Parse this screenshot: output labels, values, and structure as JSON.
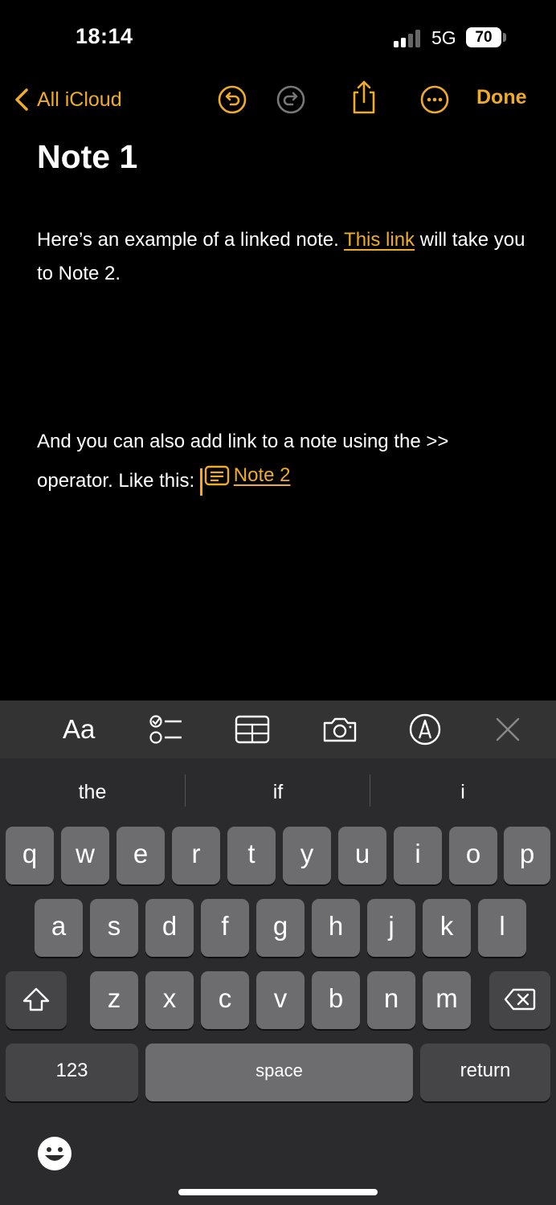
{
  "status_bar": {
    "time": "18:14",
    "network": "5G",
    "battery": "70"
  },
  "nav": {
    "back_label": "All iCloud",
    "done_label": "Done"
  },
  "note": {
    "title": "Note 1",
    "para1_before": "Here’s an example of a linked note. ",
    "para1_link": "This link",
    "para1_after": " will take you to Note 2.",
    "para2_text": "And you can also add link to a note using the >> operator. Like this: ",
    "para2_link": "Note 2"
  },
  "toolbar": {
    "format_label": "Aa"
  },
  "keyboard": {
    "suggestions": [
      "the",
      "if",
      "i"
    ],
    "row1": [
      "q",
      "w",
      "e",
      "r",
      "t",
      "y",
      "u",
      "i",
      "o",
      "p"
    ],
    "row2": [
      "a",
      "s",
      "d",
      "f",
      "g",
      "h",
      "j",
      "k",
      "l"
    ],
    "row3": [
      "z",
      "x",
      "c",
      "v",
      "b",
      "n",
      "m"
    ],
    "numbers_label": "123",
    "space_label": "space",
    "return_label": "return"
  },
  "colors": {
    "accent": "#F0AC28",
    "key": "#6D6D70",
    "key_dark": "#454548",
    "keyboard_bg": "#2B2B2D"
  }
}
